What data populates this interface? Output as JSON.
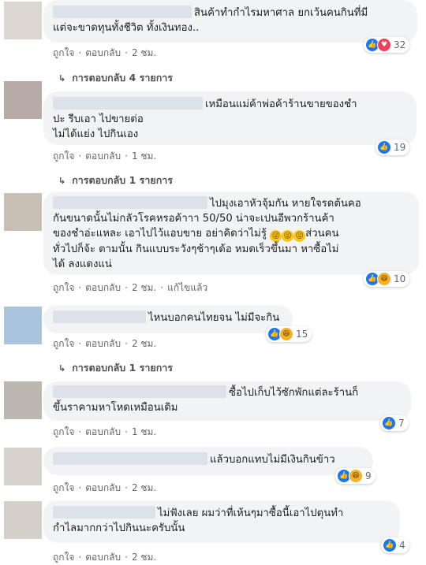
{
  "actions": {
    "like": "ถูกใจ",
    "reply": "ตอบกลับ",
    "edited": "แก้ไขแล้ว"
  },
  "comments": [
    {
      "line1": "สินค้าทำกำไรมหาศาล ยกเว้นคนกินที่มี",
      "line2": "แต่จะขาดทุนทั้งชีวิต ทั้งเงินทอง..",
      "time": "2 ชม.",
      "reactions": [
        "like-icon",
        "love-icon"
      ],
      "count": "32",
      "replies": "การตอบกลับ 4 รายการ"
    },
    {
      "line1": "เหมือนแม่ค้าพ่อค้าร้านขายของชำ",
      "line2": "ปะ รีบเอา ไปขายต่อ",
      "line3": "ไม่ได้แย่ง ไปกินเอง",
      "time": "1 ชม.",
      "reactions": [
        "like-icon"
      ],
      "count": "19",
      "replies": "การตอบกลับ 1 รายการ"
    },
    {
      "line1": "ไปมุงเอาหัวจุ้มกัน หายใจรดต้นคอ",
      "line2": "กันขนาดนั้นไม่กลัวโรคหรอค้าาา 50/50 น่าจะเปนอีพวกร้านค้า",
      "line3a": "ของชำอ่ะแหละ เอาไปไว้แอบขาย อย่าคิดว่าไม่รู้",
      "line3b": "ส่วนคน",
      "line4": "ทั่วไปก็จ้ะ ตามนั้น กินแบบระวังๆช้าๆเด้อ หมดเร็วขึ้นมา หาซื้อไม่",
      "line5": "ได้ ลงแดงแน่",
      "time": "2 ชม.",
      "reactions": [
        "like-icon",
        "haha-icon"
      ],
      "count": "10"
    },
    {
      "line1": "ไหนบอกคนไทยจน ไม่มีจะกิน",
      "time": "2 ชม.",
      "reactions": [
        "like-icon",
        "haha-icon"
      ],
      "count": "15",
      "replies": "การตอบกลับ 1 รายการ"
    },
    {
      "line1": "ซื้อไปเก็บไว้ซักพักแต่ละร้านก็",
      "line2": "ขึ้นราคามหาโหดเหมือนเดิม",
      "time": "1 ชม.",
      "reactions": [
        "like-icon"
      ],
      "count": "7"
    },
    {
      "line1": "แล้วบอกแทบไม่มีเงินกินข้าว",
      "time": "2 ชม.",
      "reactions": [
        "like-icon",
        "haha-icon"
      ],
      "count": "9"
    },
    {
      "line1": "ไม่ฟังเลย ผมว่าที่เห้นๆมาซื้อนี้เอาไปตุนทำ",
      "line2": "กำไลมากกว่าไปกินนะครับนั้น",
      "time": "2 ชม.",
      "reactions": [
        "like-icon"
      ],
      "count": "4"
    }
  ]
}
